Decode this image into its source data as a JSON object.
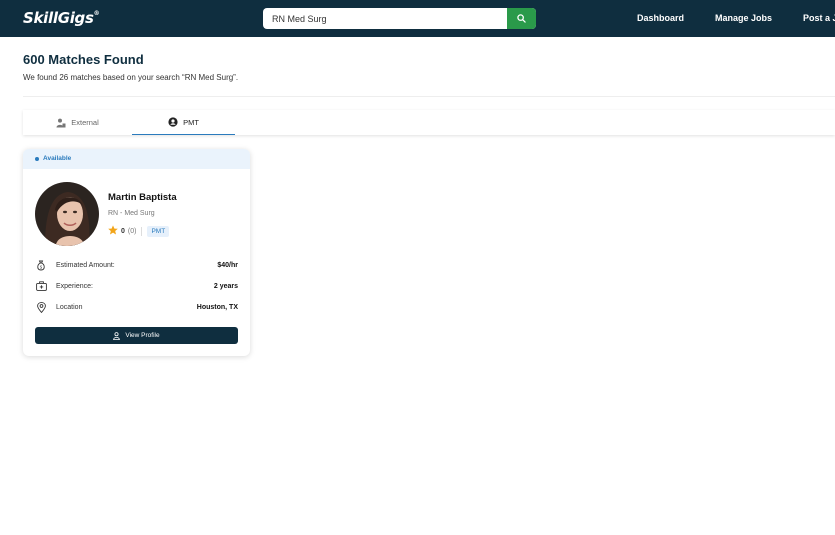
{
  "brand": {
    "logo_text": "SkillGigs",
    "reg_mark": "®"
  },
  "search": {
    "value": "RN Med Surg",
    "icon": "search-icon"
  },
  "nav": {
    "items": [
      "Dashboard",
      "Manage Jobs",
      "Post a Job"
    ]
  },
  "results": {
    "title": "600 Matches Found",
    "subtitle": "We found 26 matches based on your search “RN Med Surg”."
  },
  "tabs": [
    {
      "label": "External",
      "icon": "person-building-icon",
      "active": false
    },
    {
      "label": "PMT",
      "icon": "user-circle-icon",
      "active": true
    }
  ],
  "card": {
    "status": "Available",
    "name": "Martin Baptista",
    "role": "RN - Med Surg",
    "rating": "0",
    "rating_count": "(0)",
    "badge": "PMT",
    "rows": [
      {
        "label": "Estimated Amount:",
        "value": "$40/hr",
        "icon": "money-bag-icon"
      },
      {
        "label": "Experience:",
        "value": "2 years",
        "icon": "medical-kit-icon"
      },
      {
        "label": "Location",
        "value": "Houston, TX",
        "icon": "location-pin-icon"
      }
    ],
    "button": "View Profile"
  },
  "colors": {
    "nav_bg": "#0f2e3f",
    "accent": "#2b7bbd",
    "search_btn": "#2a9a4a",
    "star": "#f2a51a"
  }
}
